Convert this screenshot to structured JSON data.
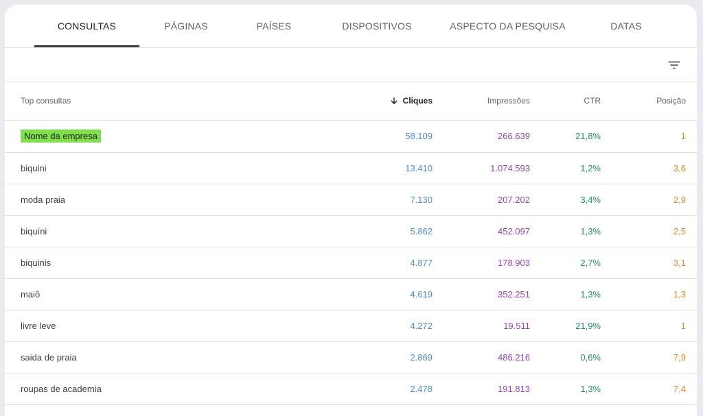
{
  "tabs": [
    {
      "label": "CONSULTAS",
      "active": true
    },
    {
      "label": "PÁGINAS",
      "active": false
    },
    {
      "label": "PAÍSES",
      "active": false
    },
    {
      "label": "DISPOSITIVOS",
      "active": false
    },
    {
      "label": "ASPECTO DA PESQUISA",
      "active": false
    },
    {
      "label": "DATAS",
      "active": false
    }
  ],
  "toolbar": {
    "filter_icon": "filter-list-icon"
  },
  "table": {
    "columns": {
      "query": "Top consultas",
      "clicks": "Cliques",
      "impressions": "Impressões",
      "ctr": "CTR",
      "position": "Posição"
    },
    "sorted_by": "clicks",
    "sort_direction": "desc",
    "rows": [
      {
        "query": "Nome da empresa",
        "clicks": "58.109",
        "impressions": "266.639",
        "ctr": "21,8%",
        "position": "1",
        "highlighted": true
      },
      {
        "query": "biquini",
        "clicks": "13.410",
        "impressions": "1.074.593",
        "ctr": "1,2%",
        "position": "3,6"
      },
      {
        "query": "moda praia",
        "clicks": "7.130",
        "impressions": "207.202",
        "ctr": "3,4%",
        "position": "2,9"
      },
      {
        "query": "biquíni",
        "clicks": "5.862",
        "impressions": "452.097",
        "ctr": "1,3%",
        "position": "2,5"
      },
      {
        "query": "biquinis",
        "clicks": "4.877",
        "impressions": "178.903",
        "ctr": "2,7%",
        "position": "3,1"
      },
      {
        "query": "maiô",
        "clicks": "4.619",
        "impressions": "352.251",
        "ctr": "1,3%",
        "position": "1,3"
      },
      {
        "query": "livre leve",
        "clicks": "4.272",
        "impressions": "19.511",
        "ctr": "21,9%",
        "position": "1"
      },
      {
        "query": "saida de praia",
        "clicks": "2.869",
        "impressions": "486.216",
        "ctr": "0,6%",
        "position": "7,9"
      },
      {
        "query": "roupas de academia",
        "clicks": "2.478",
        "impressions": "191.813",
        "ctr": "1,3%",
        "position": "7,4"
      }
    ]
  },
  "colors": {
    "clicks": "#4a90c9",
    "impressions": "#9b3fb5",
    "ctr": "#1e8e6e",
    "position": "#e08a1e",
    "highlight": "#7fe04a"
  }
}
